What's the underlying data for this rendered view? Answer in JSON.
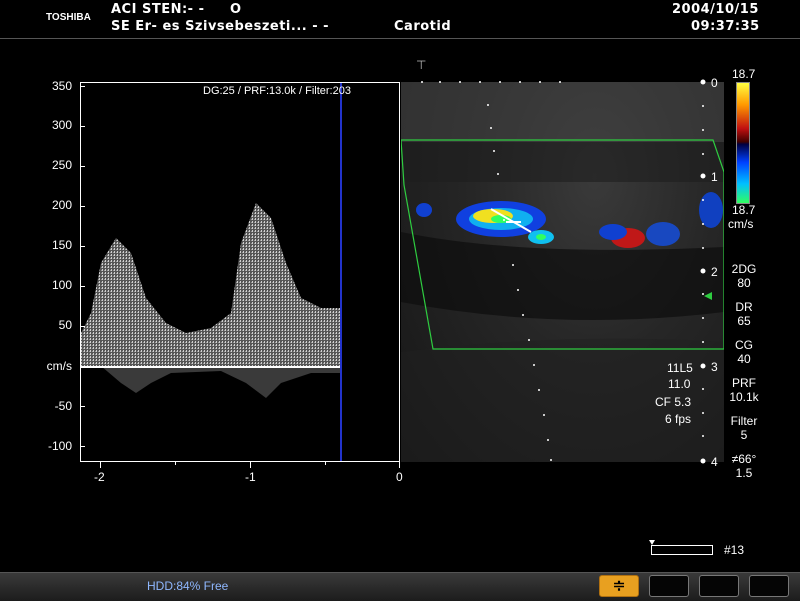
{
  "header": {
    "brand": "TOSHIBA",
    "exam_label": "ACI STEN:- -",
    "exam_mark": "O",
    "institution": "SE Er- es Szivsebeszeti...  -  -",
    "study": "Carotid",
    "date": "2004/10/15",
    "time": "09:37:35"
  },
  "doppler": {
    "info": "DG:25 /   PRF:13.0k / Filter:203",
    "y_unit": "cm/s",
    "y_ticks": [
      "350",
      "300",
      "250",
      "200",
      "150",
      "100",
      "50",
      "-50",
      "-100"
    ],
    "x_ticks": [
      "-2",
      "-1",
      "0"
    ]
  },
  "colorbar": {
    "top_value": "18.7",
    "bottom_value": "18.7",
    "unit": "cm/s",
    "colors": [
      "#ffff40",
      "#ff9a00",
      "#c01010",
      "#400000",
      "#000040",
      "#0040ff",
      "#00c0ff",
      "#30ff60"
    ]
  },
  "depth_scale": [
    "0",
    "1",
    "2",
    "3",
    "4"
  ],
  "params": {
    "dg_label": "2DG",
    "dg_value": "80",
    "dr_label": "DR",
    "dr_value": "65",
    "cg_label": "CG",
    "cg_value": "40",
    "prf_label": "PRF",
    "prf_value": "10.1k",
    "filter_label": "Filter",
    "filter_value": "5",
    "angle": "≠66°",
    "angle_value": "1.5"
  },
  "probe": {
    "model": "11L5",
    "freq": "11.0",
    "cf": "CF 5.3",
    "fps": "6 fps"
  },
  "cine": {
    "frame": "#13"
  },
  "status": {
    "hdd": "HDD:84% Free",
    "freeze_symbol": "≑"
  },
  "accent": {
    "roi_green": "#2ecc40",
    "baseline": "#ffffff",
    "cursor_blue": "#2233cc",
    "freeze_yellow": "#e8a020"
  }
}
